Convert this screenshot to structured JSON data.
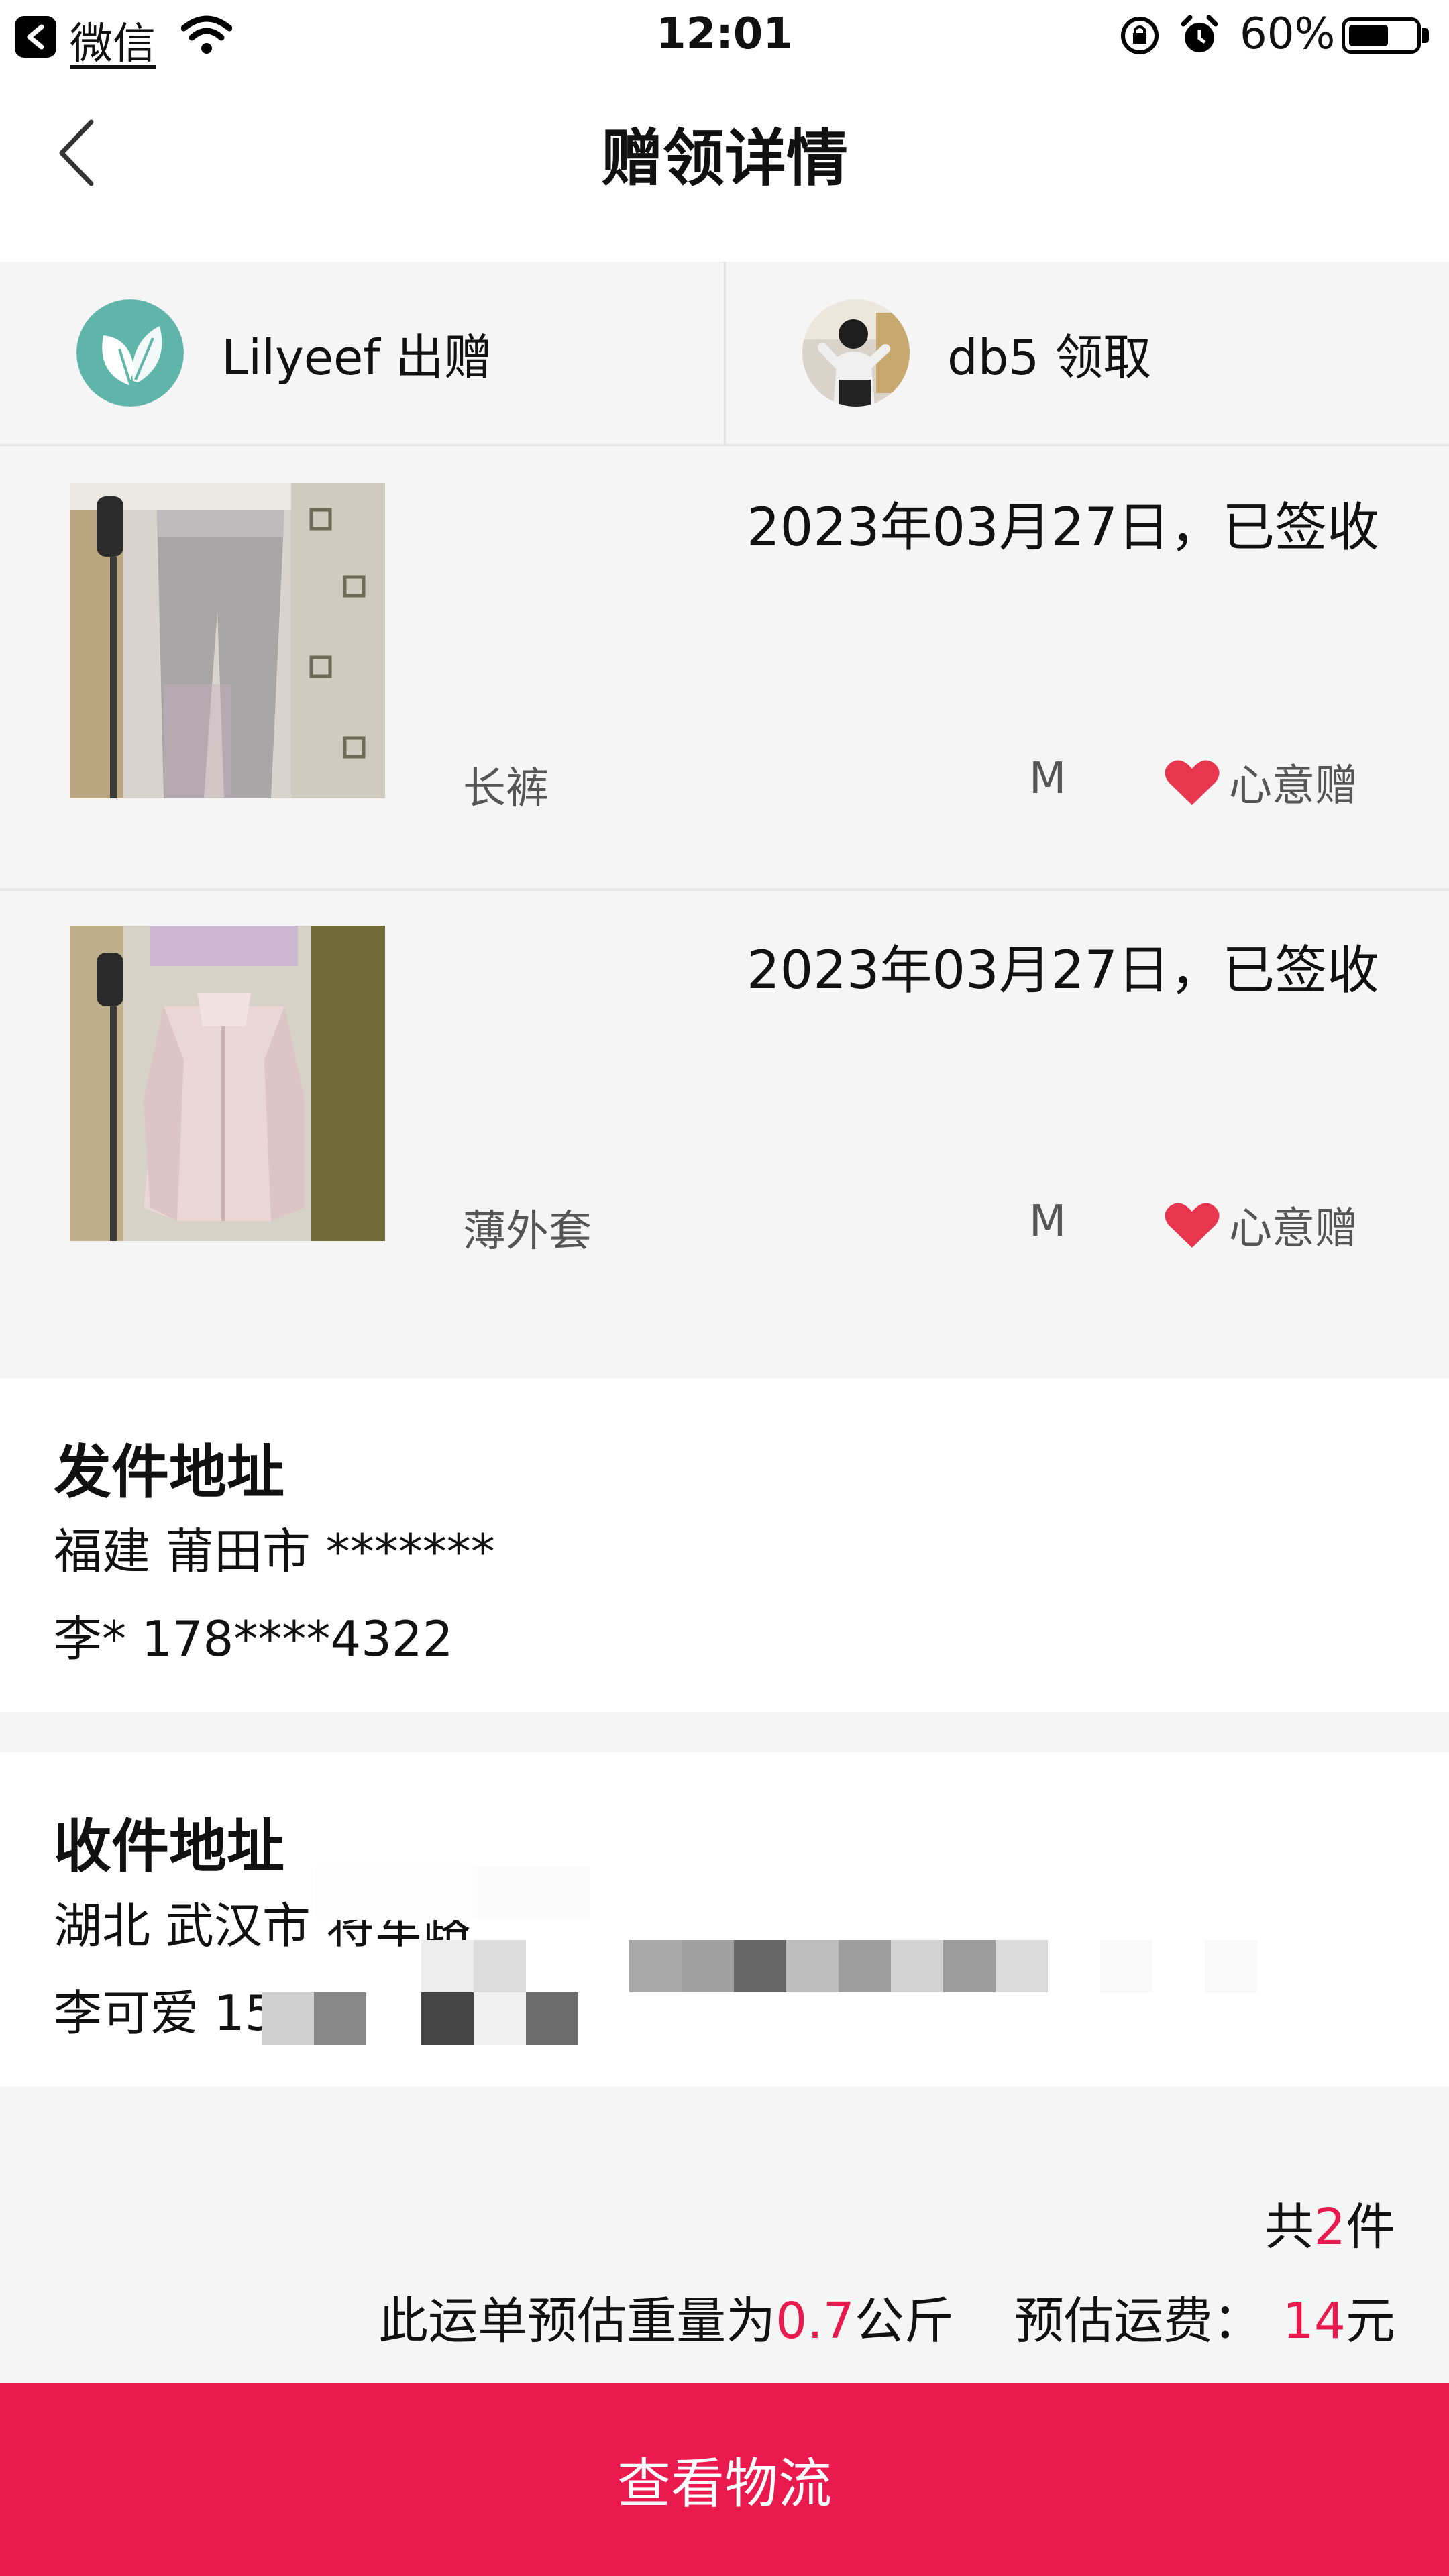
{
  "status_bar": {
    "app_name": "微信",
    "time": "12:01",
    "battery_percent": "60%",
    "battery_level": 0.6
  },
  "nav": {
    "title": "赠领详情"
  },
  "users": {
    "giver": {
      "name": "Lilyeef 出赠"
    },
    "receiver": {
      "name": "db5 领取"
    }
  },
  "items": [
    {
      "date_status": "2023年03月27日，已签收",
      "name": "长裤",
      "size": "M",
      "tag": "心意赠"
    },
    {
      "date_status": "2023年03月27日，已签收",
      "name": "薄外套",
      "size": "M",
      "tag": "心意赠"
    }
  ],
  "sender_address": {
    "title": "发件地址",
    "line1": "福建 莆田市 *******",
    "line2": "李* 178****4322"
  },
  "receiver_address": {
    "title": "收件地址",
    "line1": "湖北 武汉市 将军路",
    "line2": "李可爱 15"
  },
  "summary": {
    "count_prefix": "共",
    "count": "2",
    "count_suffix": "件",
    "weight_prefix": "此运单预估重量为",
    "weight": "0.7",
    "weight_unit": "公斤",
    "fee_label": "预估运费：",
    "fee": "14",
    "fee_unit": "元"
  },
  "colors": {
    "accent": "#ea1a4f",
    "heart": "#e8364f"
  },
  "bottom_button": {
    "label": "查看物流"
  }
}
